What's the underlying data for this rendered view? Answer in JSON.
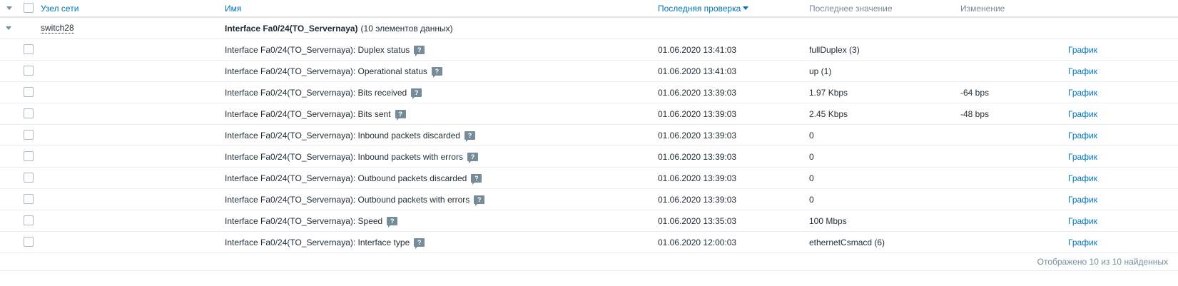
{
  "header": {
    "host": "Узел сети",
    "name": "Имя",
    "last_check": "Последняя проверка",
    "last_value": "Последнее значение",
    "change": "Изменение"
  },
  "group": {
    "host": "switch28",
    "application": "Interface Fa0/24(TO_Servernaya)",
    "count": "(10 элементов данных)"
  },
  "rows": [
    {
      "name": "Interface Fa0/24(TO_Servernaya): Duplex status",
      "last_check": "01.06.2020 13:41:03",
      "last_value": "fullDuplex (3)",
      "change": "",
      "action": "График"
    },
    {
      "name": "Interface Fa0/24(TO_Servernaya): Operational status",
      "last_check": "01.06.2020 13:41:03",
      "last_value": "up (1)",
      "change": "",
      "action": "График"
    },
    {
      "name": "Interface Fa0/24(TO_Servernaya): Bits received",
      "last_check": "01.06.2020 13:39:03",
      "last_value": "1.97 Kbps",
      "change": "-64 bps",
      "action": "График"
    },
    {
      "name": "Interface Fa0/24(TO_Servernaya): Bits sent",
      "last_check": "01.06.2020 13:39:03",
      "last_value": "2.45 Kbps",
      "change": "-48 bps",
      "action": "График"
    },
    {
      "name": "Interface Fa0/24(TO_Servernaya): Inbound packets discarded",
      "last_check": "01.06.2020 13:39:03",
      "last_value": "0",
      "change": "",
      "action": "График"
    },
    {
      "name": "Interface Fa0/24(TO_Servernaya): Inbound packets with errors",
      "last_check": "01.06.2020 13:39:03",
      "last_value": "0",
      "change": "",
      "action": "График"
    },
    {
      "name": "Interface Fa0/24(TO_Servernaya): Outbound packets discarded",
      "last_check": "01.06.2020 13:39:03",
      "last_value": "0",
      "change": "",
      "action": "График"
    },
    {
      "name": "Interface Fa0/24(TO_Servernaya): Outbound packets with errors",
      "last_check": "01.06.2020 13:39:03",
      "last_value": "0",
      "change": "",
      "action": "График"
    },
    {
      "name": "Interface Fa0/24(TO_Servernaya): Speed",
      "last_check": "01.06.2020 13:35:03",
      "last_value": "100 Mbps",
      "change": "",
      "action": "График"
    },
    {
      "name": "Interface Fa0/24(TO_Servernaya): Interface type",
      "last_check": "01.06.2020 12:00:03",
      "last_value": "ethernetCsmacd (6)",
      "change": "",
      "action": "График"
    }
  ],
  "hint_glyph": "?",
  "footer": "Отображено 10 из 10 найденных"
}
